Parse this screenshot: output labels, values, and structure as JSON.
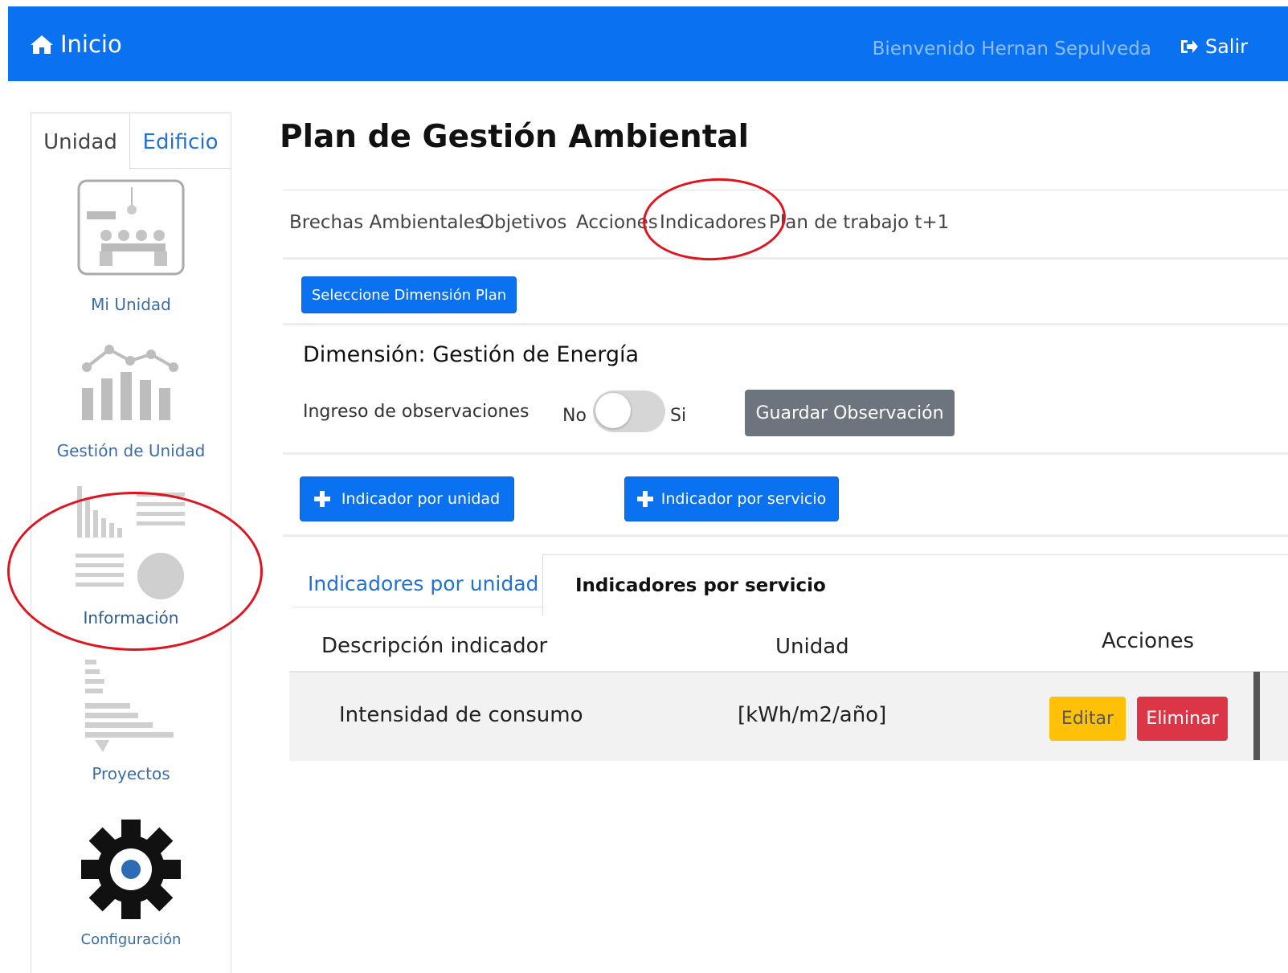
{
  "navbar": {
    "home_label": "Inicio",
    "welcome": "Bienvenido Hernan Sepulveda",
    "logout_label": "Salir"
  },
  "sidebar": {
    "tabs": [
      {
        "label": "Unidad",
        "active": true
      },
      {
        "label": "Edificio",
        "active": false
      }
    ],
    "items": [
      {
        "label": "Mi Unidad",
        "icon": "meeting-room-icon"
      },
      {
        "label": "Gestión de Unidad",
        "icon": "bar-line-chart-icon"
      },
      {
        "label": "Información",
        "icon": "info-charts-icon"
      },
      {
        "label": "Proyectos",
        "icon": "gantt-chart-icon"
      },
      {
        "label": "Configuración",
        "icon": "gear-icon"
      }
    ]
  },
  "main": {
    "title": "Plan de Gestión Ambiental",
    "tabs": [
      {
        "label": "Brechas Ambientales"
      },
      {
        "label": "Objetivos"
      },
      {
        "label": "Acciones"
      },
      {
        "label": "Indicadores"
      },
      {
        "label": "Plan de trabajo t+1"
      }
    ],
    "select_dimension_button": "Seleccione Dimensión Plan",
    "dimension_label": "Dimensión: Gestión de Energía",
    "observations": {
      "label": "Ingreso de observaciones",
      "toggle_off": "No",
      "toggle_on": "Si",
      "save_button": "Guardar Observación"
    },
    "add_indicator_unit_button": "Indicador por unidad",
    "add_indicator_service_button": "Indicador por servicio",
    "subtabs": [
      {
        "label": "Indicadores por unidad",
        "active": false
      },
      {
        "label": "Indicadores por servicio",
        "active": true
      }
    ],
    "table": {
      "headers": [
        "Descripción indicador",
        "Unidad",
        "Acciones"
      ],
      "rows": [
        {
          "description": "Intensidad de consumo",
          "unit": "[kWh/m2/año]"
        }
      ],
      "edit_label": "Editar",
      "delete_label": "Eliminar"
    }
  },
  "colors": {
    "primary": "#0a72f0",
    "secondary": "#6c757d",
    "warning": "#ffc107",
    "danger": "#dc3545",
    "annotation": "#e0141f"
  }
}
